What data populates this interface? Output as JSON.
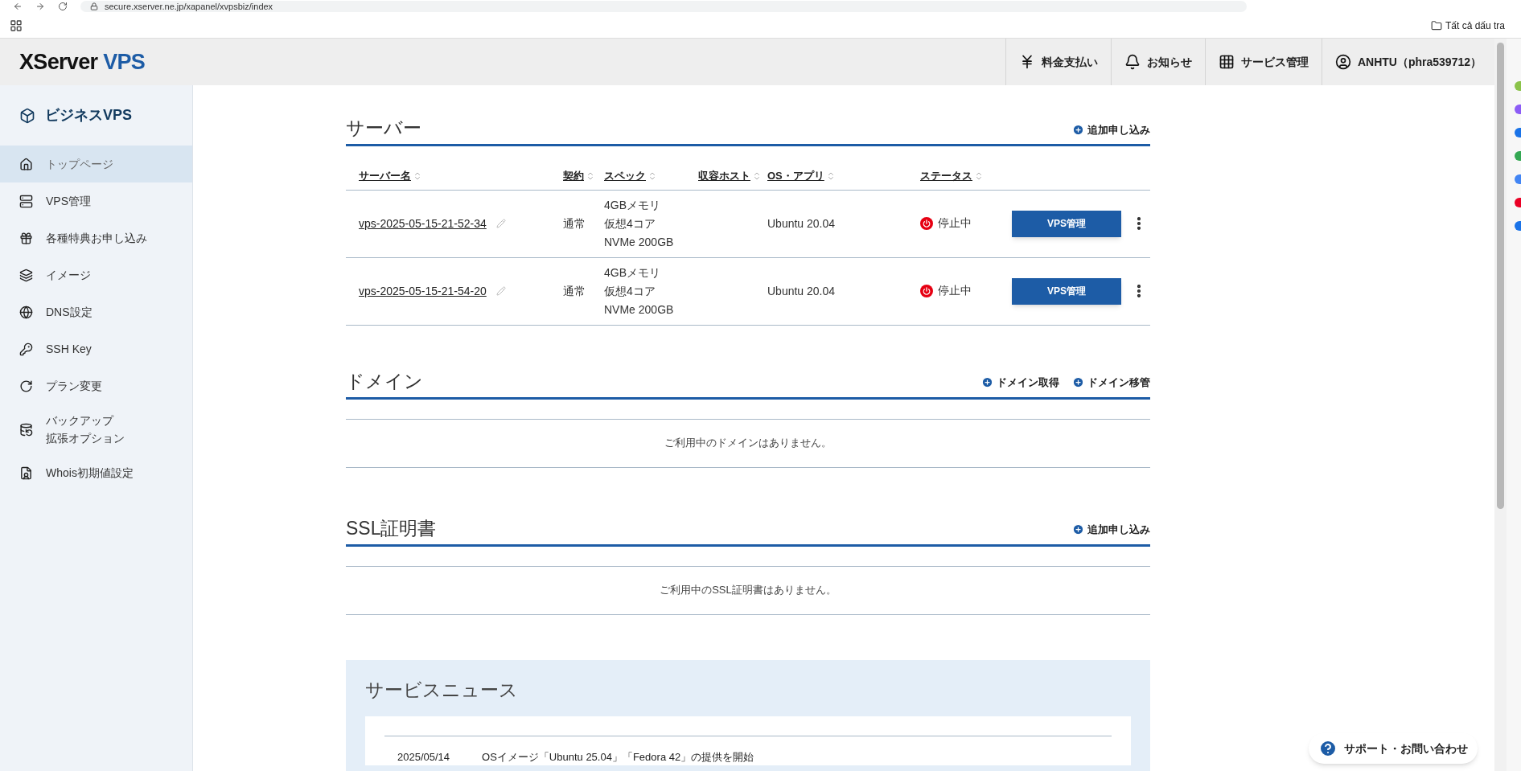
{
  "browser": {
    "url": "secure.xserver.ne.jp/xapanel/xvpsbiz/index",
    "bookmarks_folder": "Tất cả dấu tra"
  },
  "header": {
    "logo_main": "XServer",
    "logo_sub": "VPS",
    "nav": [
      {
        "kind": "yen",
        "label": "料金支払い"
      },
      {
        "kind": "bell",
        "label": "お知らせ"
      },
      {
        "kind": "grid",
        "label": "サービス管理"
      },
      {
        "kind": "user",
        "label": "ANHTU（phra539712）"
      }
    ]
  },
  "sidebar": {
    "title": "ビジネスVPS",
    "items": [
      {
        "kind": "home",
        "label": "トップページ",
        "selected": true
      },
      {
        "kind": "server",
        "label": "VPS管理",
        "selected": false
      },
      {
        "kind": "gift",
        "label": "各種特典お申し込み",
        "selected": false
      },
      {
        "kind": "layers",
        "label": "イメージ",
        "selected": false
      },
      {
        "kind": "globe",
        "label": "DNS設定",
        "selected": false
      },
      {
        "kind": "key",
        "label": "SSH Key",
        "selected": false
      },
      {
        "kind": "refresh",
        "label": "プラン変更",
        "selected": false
      },
      {
        "kind": "backup",
        "label_lines": [
          "バックアップ",
          "拡張オプション"
        ],
        "selected": false
      },
      {
        "kind": "whois",
        "label": "Whois初期値設定",
        "selected": false
      }
    ]
  },
  "servers": {
    "title": "サーバー",
    "action": "追加申し込み",
    "columns": [
      "サーバー名",
      "契約",
      "スペック",
      "収容ホスト",
      "OS・アプリ",
      "ステータス"
    ],
    "rows": [
      {
        "name": "vps-2025-05-15-21-52-34",
        "contract": "通常",
        "spec": [
          "4GBメモリ",
          "仮想4コア",
          "NVMe 200GB"
        ],
        "os": "Ubuntu 20.04",
        "status": "停止中",
        "running": false,
        "button": "VPS管理"
      },
      {
        "name": "vps-2025-05-15-21-54-20",
        "contract": "通常",
        "spec": [
          "4GBメモリ",
          "仮想4コア",
          "NVMe 200GB"
        ],
        "os": "Ubuntu 20.04",
        "status": "停止中",
        "running": false,
        "button": "VPS管理"
      }
    ]
  },
  "domains": {
    "title": "ドメイン",
    "actions": [
      "ドメイン取得",
      "ドメイン移管"
    ],
    "empty": "ご利用中のドメインはありません。"
  },
  "ssl": {
    "title": "SSL証明書",
    "actions": [
      "追加申し込み"
    ],
    "empty": "ご利用中のSSL証明書はありません。"
  },
  "news": {
    "title": "サービスニュース",
    "items": [
      {
        "date": "2025/05/14",
        "text": "OSイメージ「Ubuntu 25.04」「Fedora 42」の提供を開始"
      }
    ]
  },
  "support": {
    "label": "サポート・お問い合わせ"
  }
}
